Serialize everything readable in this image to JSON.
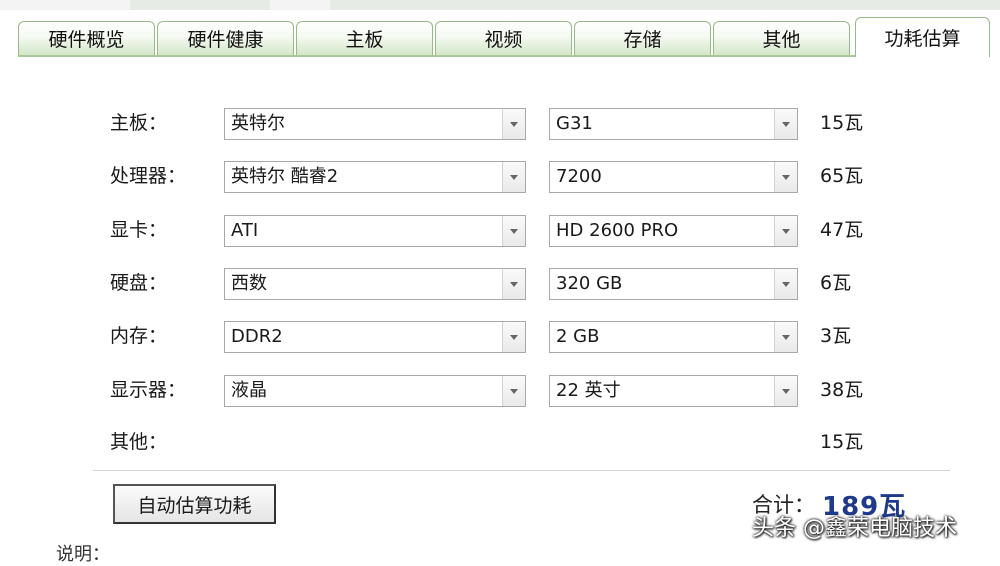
{
  "tabs": [
    {
      "label": "硬件概览",
      "active": false
    },
    {
      "label": "硬件健康",
      "active": false
    },
    {
      "label": "主板",
      "active": false
    },
    {
      "label": "视频",
      "active": false
    },
    {
      "label": "存储",
      "active": false
    },
    {
      "label": "其他",
      "active": false
    },
    {
      "label": "功耗估算",
      "active": true
    }
  ],
  "rows": [
    {
      "label": "主板：",
      "brand": "英特尔",
      "model": "G31",
      "watts": "15瓦"
    },
    {
      "label": "处理器：",
      "brand": "英特尔 酷睿2",
      "model": "7200",
      "watts": "65瓦"
    },
    {
      "label": "显卡：",
      "brand": "ATI",
      "model": "HD 2600 PRO",
      "watts": "47瓦"
    },
    {
      "label": "硬盘：",
      "brand": "西数",
      "model": "320 GB",
      "watts": "6瓦"
    },
    {
      "label": "内存：",
      "brand": "DDR2",
      "model": "2 GB",
      "watts": "3瓦"
    },
    {
      "label": "显示器：",
      "brand": "液晶",
      "model": "22 英寸",
      "watts": "38瓦"
    }
  ],
  "other": {
    "label": "其他：",
    "watts": "15瓦"
  },
  "button": {
    "label": "自动估算功耗"
  },
  "total": {
    "label": "合计：",
    "value": "189瓦"
  },
  "note": {
    "label": "说明："
  },
  "watermark": "头条 @鑫荣电脑技术",
  "colors": {
    "tab_border": "#97b989",
    "total_value": "#1f3a8a"
  }
}
